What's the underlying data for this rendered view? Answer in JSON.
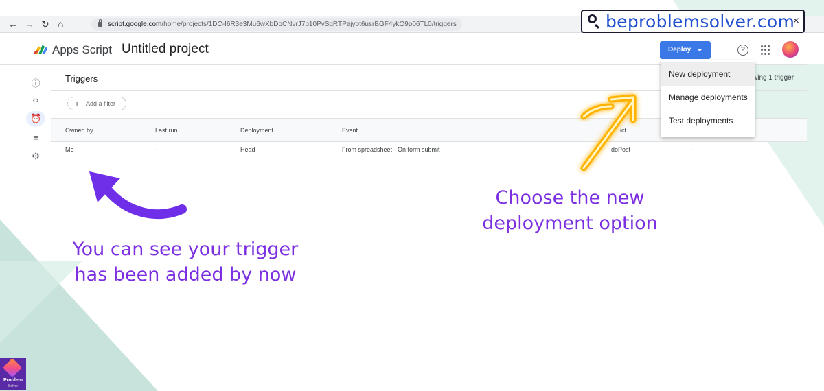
{
  "browser": {
    "url_host": "script.google.com",
    "url_path": "/home/projects/1DC-I6R3e3Mu6wXbDoCNvrJ7b10PvSgRTPajyot6usrBGF4ykO9p06TL0/triggers"
  },
  "watermark": {
    "text": "beproblemsolver.com",
    "close": "×"
  },
  "app": {
    "name": "Apps Script",
    "project": "Untitled project",
    "deploy_label": "Deploy",
    "help_glyph": "?"
  },
  "panel": {
    "title": "Triggers",
    "showing": "wing 1 trigger",
    "filter_label": "Add a filter"
  },
  "table": {
    "headers": {
      "owned_by": "Owned by",
      "last_run": "Last run",
      "deployment": "Deployment",
      "event": "Event",
      "function": "ict"
    },
    "row": {
      "owned_by": "Me",
      "last_run": "-",
      "deployment": "Head",
      "event": "From spreadsheet - On form submit",
      "function": "doPost",
      "extra": "-"
    }
  },
  "menu": {
    "items": [
      {
        "label": "New deployment"
      },
      {
        "label": "Manage deployments"
      },
      {
        "label": "Test deployments"
      }
    ]
  },
  "annotations": {
    "left_line1": "You can see your trigger",
    "left_line2": "has been added by now",
    "right_line1": "Choose the new",
    "right_line2": "deployment option"
  },
  "brand": {
    "line1": "Problem",
    "line2": "Solver"
  },
  "colors": {
    "accent": "#3b78e7",
    "annotation": "#7b2fe0",
    "highlight_arrow": "#ffb300"
  }
}
